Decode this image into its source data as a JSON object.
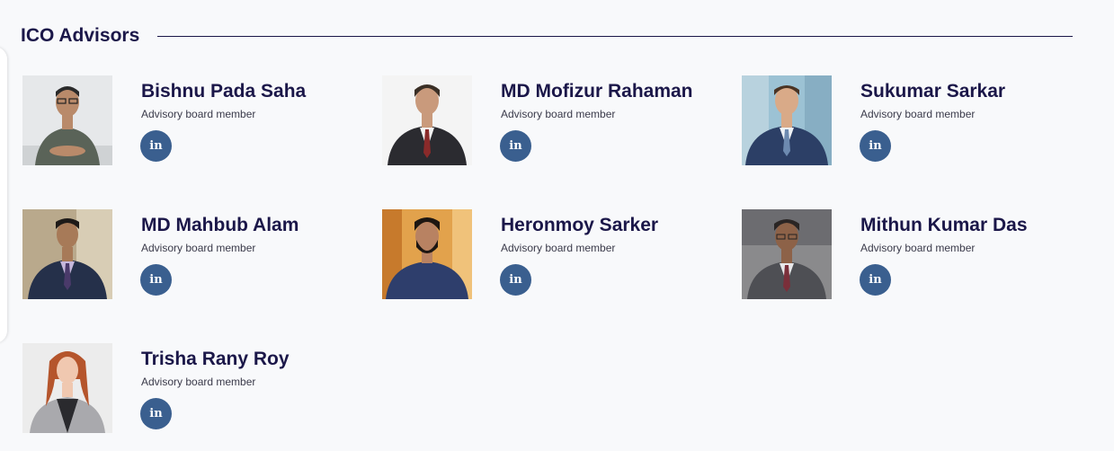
{
  "section": {
    "title": "ICO Advisors"
  },
  "advisors": [
    {
      "name": "Bishnu Pada Saha",
      "role": "Advisory board member",
      "linkedin_label": "in"
    },
    {
      "name": "MD Mofizur Rahaman",
      "role": "Advisory board member",
      "linkedin_label": "in"
    },
    {
      "name": "Sukumar Sarkar",
      "role": "Advisory board member",
      "linkedin_label": "in"
    },
    {
      "name": "MD Mahbub Alam",
      "role": "Advisory board member",
      "linkedin_label": "in"
    },
    {
      "name": "Heronmoy Sarker",
      "role": "Advisory board member",
      "linkedin_label": "in"
    },
    {
      "name": "Mithun Kumar Das",
      "role": "Advisory board member",
      "linkedin_label": "in"
    },
    {
      "name": "Trisha Rany Roy",
      "role": "Advisory board member",
      "linkedin_label": "in"
    }
  ],
  "colors": {
    "heading": "#1b1749",
    "linkedin_button": "#3a5f8f",
    "background": "#f8f9fb"
  }
}
